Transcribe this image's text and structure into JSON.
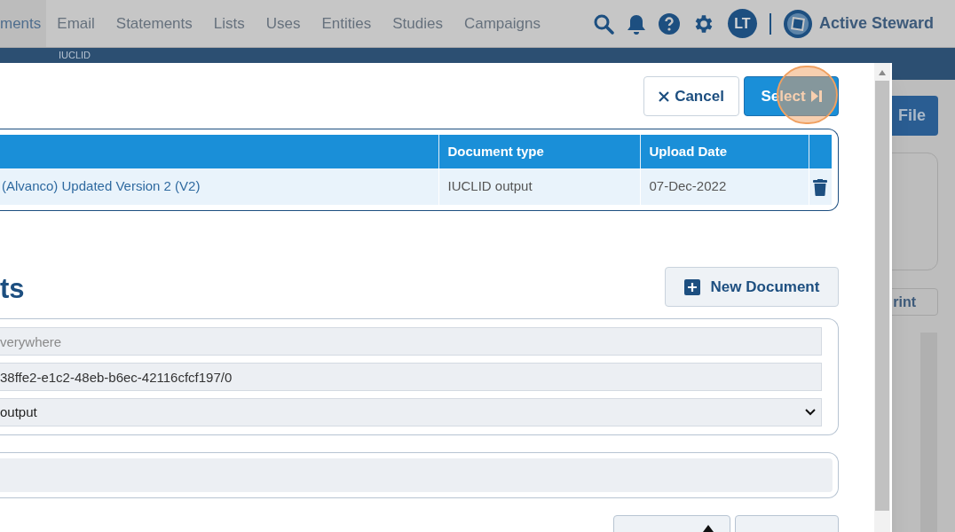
{
  "nav": {
    "items": [
      {
        "label": "ments",
        "selected": true
      },
      {
        "label": "Email",
        "selected": false
      },
      {
        "label": "Statements",
        "selected": false
      },
      {
        "label": "Lists",
        "selected": false
      },
      {
        "label": "Uses",
        "selected": false
      },
      {
        "label": "Entities",
        "selected": false
      },
      {
        "label": "Studies",
        "selected": false
      },
      {
        "label": "Campaigns",
        "selected": false
      }
    ],
    "avatar": "LT",
    "brand": "Active Steward"
  },
  "breadcrumb": "IUCLID",
  "background_buttons": [
    "File",
    "rint"
  ],
  "modal": {
    "buttons": [
      {
        "kind": "cancel",
        "label": "Cancel"
      },
      {
        "kind": "select",
        "label": "Select"
      }
    ],
    "table": {
      "columns": [
        "Document type",
        "Upload Date"
      ],
      "rows": [
        {
          "name": "(Alvanco) Updated Version 2 (V2)",
          "document_type": "IUCLID output",
          "upload_date": "07-Dec-2022"
        }
      ]
    },
    "heading": "ts",
    "new_document_button": "New Document",
    "filters": [
      {
        "kind": "text",
        "placeholder": "verywhere"
      },
      {
        "kind": "text",
        "value": "38ffe2-e1c2-48eb-b6ec-42116cfcf197/0"
      },
      {
        "kind": "select",
        "value": "output"
      }
    ]
  }
}
